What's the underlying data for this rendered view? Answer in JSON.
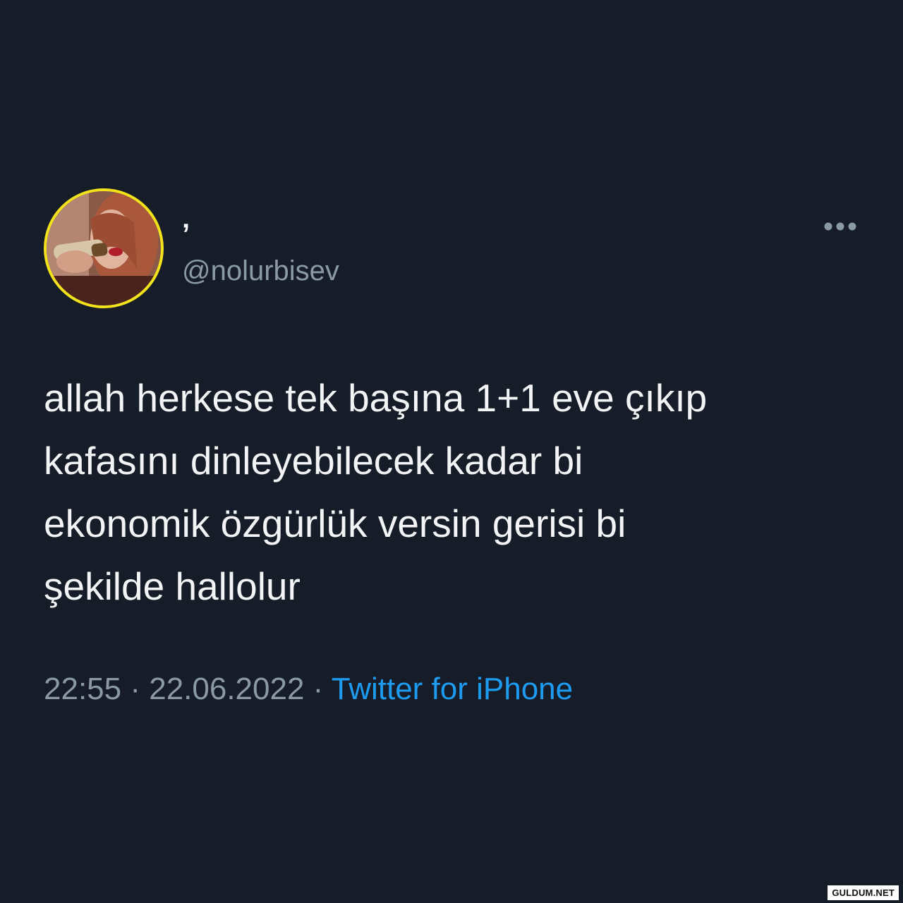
{
  "tweet": {
    "display_name": "’",
    "handle": "@nolurbisev",
    "text": "allah herkese tek başına 1+1 eve çıkıp\nkafasını dinleyebilecek kadar bi\nekonomik özgürlük versin gerisi bi\nşekilde hallolur",
    "time": "22:55",
    "separator": " · ",
    "date": "22.06.2022",
    "source": "Twitter for iPhone",
    "more_icon": "more-horizontal-icon",
    "avatar_icon": "profile-avatar"
  },
  "watermark": {
    "text": "GULDUM.NET"
  },
  "colors": {
    "background": "#161d29",
    "text": "#f2f4f5",
    "muted": "#8b98a5",
    "link": "#1d9bf0",
    "avatar_ring": "#f2e21a"
  }
}
